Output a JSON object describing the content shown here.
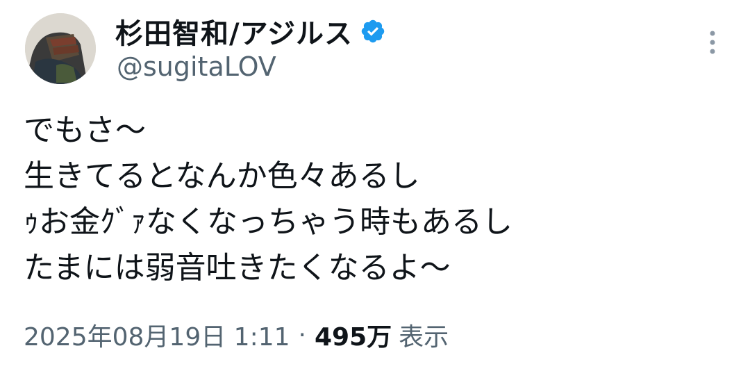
{
  "author": {
    "display_name": "杉田智和/アジルス",
    "handle": "@sugitaLOV",
    "verified": true,
    "verified_color": "#1d9bf0"
  },
  "tweet": {
    "lines": [
      "でもさ〜",
      "生きてるとなんか色々あるし",
      "ｩお金ｸﾞｧなくなっちゃう時もあるし",
      "たまには弱音吐きたくなるよ〜"
    ]
  },
  "meta": {
    "datetime": "2025年08月19日 1:11",
    "separator": "·",
    "views_count": "495万",
    "views_label": "表示"
  },
  "icons": {
    "more": "more-vertical-icon",
    "verified": "verified-badge-icon"
  }
}
